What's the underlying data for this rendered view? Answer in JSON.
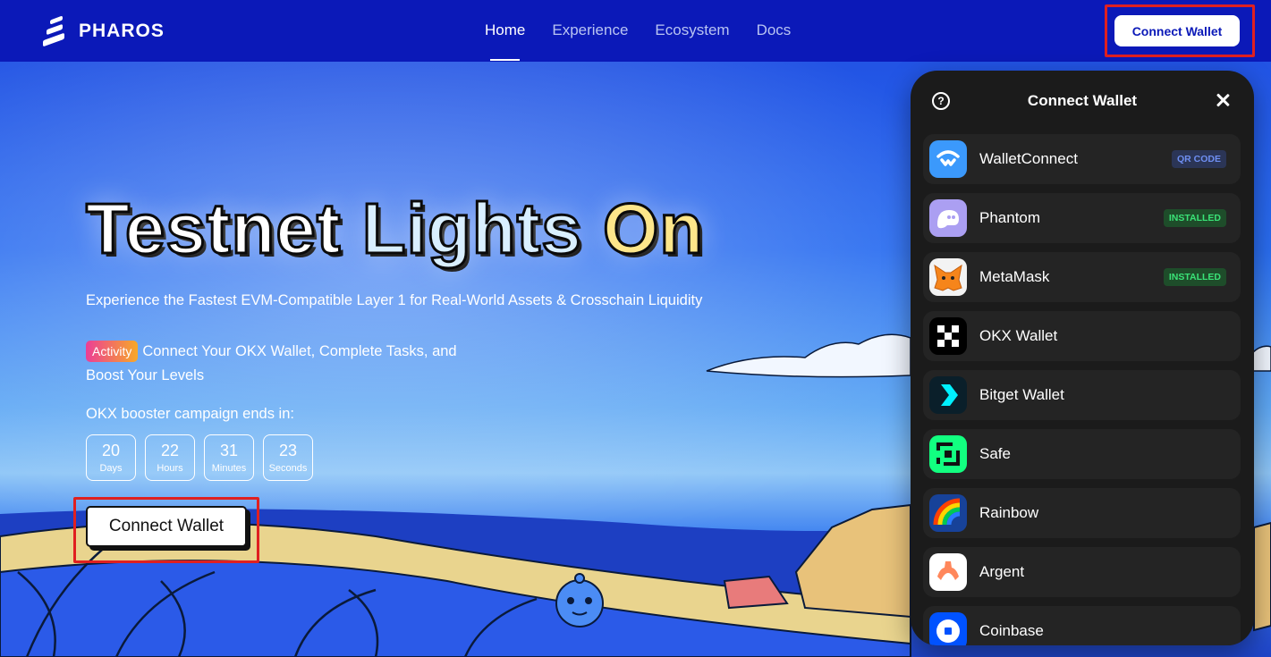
{
  "brand": {
    "name": "PHAROS"
  },
  "nav": {
    "items": [
      {
        "label": "Home",
        "active": true
      },
      {
        "label": "Experience",
        "active": false
      },
      {
        "label": "Ecosystem",
        "active": false
      },
      {
        "label": "Docs",
        "active": false
      }
    ],
    "connect_label": "Connect Wallet"
  },
  "hero": {
    "title_words": [
      "Testnet",
      "Lights",
      "On"
    ],
    "subtitle": "Experience the Fastest EVM-Compatible Layer 1 for Real-World Assets & Crosschain Liquidity",
    "activity_badge": "Activity",
    "activity_text": "Connect Your OKX Wallet, Complete Tasks, and Boost Your Levels",
    "campaign_text": "OKX booster campaign ends in:",
    "countdown": [
      {
        "value": "20",
        "unit": "Days"
      },
      {
        "value": "22",
        "unit": "Hours"
      },
      {
        "value": "31",
        "unit": "Minutes"
      },
      {
        "value": "23",
        "unit": "Seconds"
      }
    ],
    "connect_label": "Connect Wallet"
  },
  "modal": {
    "title": "Connect Wallet",
    "wallets": [
      {
        "name": "WalletConnect",
        "tag": "QR CODE",
        "tag_type": "qr",
        "icon": "walletconnect-icon",
        "color": "#3b99fc"
      },
      {
        "name": "Phantom",
        "tag": "INSTALLED",
        "tag_type": "inst",
        "icon": "phantom-icon",
        "color": "#ab9ff2"
      },
      {
        "name": "MetaMask",
        "tag": "INSTALLED",
        "tag_type": "inst",
        "icon": "metamask-icon",
        "color": "#f6851b"
      },
      {
        "name": "OKX Wallet",
        "tag": "",
        "tag_type": "",
        "icon": "okx-icon",
        "color": "#000000"
      },
      {
        "name": "Bitget Wallet",
        "tag": "",
        "tag_type": "",
        "icon": "bitget-icon",
        "color": "#00f0ff"
      },
      {
        "name": "Safe",
        "tag": "",
        "tag_type": "",
        "icon": "safe-icon",
        "color": "#12ff80"
      },
      {
        "name": "Rainbow",
        "tag": "",
        "tag_type": "",
        "icon": "rainbow-icon",
        "color": "#174299"
      },
      {
        "name": "Argent",
        "tag": "",
        "tag_type": "",
        "icon": "argent-icon",
        "color": "#ff875b"
      },
      {
        "name": "Coinbase",
        "tag": "",
        "tag_type": "",
        "icon": "coinbase-icon",
        "color": "#0052ff"
      }
    ]
  },
  "colors": {
    "nav_bg": "#0b19b8",
    "highlight_frame": "#e02020",
    "modal_bg": "#1b1b1b"
  }
}
